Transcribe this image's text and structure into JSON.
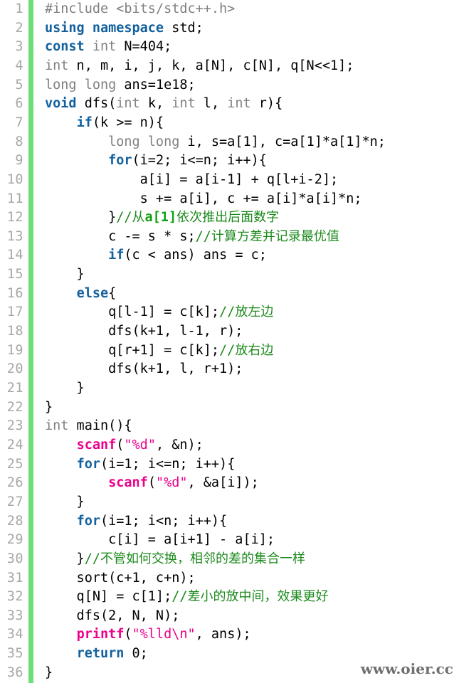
{
  "editor": {
    "language": "cpp",
    "background_color": "#ffffff",
    "gutter_bar_color": "#6fdd78",
    "line_number_color": "#a7a7a7",
    "total_lines": 36,
    "colors": {
      "keyword": "#12619e",
      "type": "#808080",
      "preprocessor": "#808080",
      "comment": "#1c8a1c",
      "comment_emphasis": "#13a013",
      "function": "#ec008c",
      "string": "#ec008c",
      "plain": "#000000"
    }
  },
  "watermark": {
    "text": "www.oier.cc"
  },
  "lines": [
    {
      "n": "1",
      "tokens": [
        {
          "t": "preproc",
          "s": "#include <bits/stdc++.h>"
        }
      ]
    },
    {
      "n": "2",
      "tokens": [
        {
          "t": "keyword",
          "s": "using namespace"
        },
        {
          "t": "plain",
          "s": " std;"
        }
      ]
    },
    {
      "n": "3",
      "tokens": [
        {
          "t": "keyword",
          "s": "const"
        },
        {
          "t": "plain",
          "s": " "
        },
        {
          "t": "type",
          "s": "int"
        },
        {
          "t": "plain",
          "s": " N=404;"
        }
      ]
    },
    {
      "n": "4",
      "tokens": [
        {
          "t": "type",
          "s": "int"
        },
        {
          "t": "plain",
          "s": " n, m, i, j, k, a[N], c[N], q[N<<1];"
        }
      ]
    },
    {
      "n": "5",
      "tokens": [
        {
          "t": "type",
          "s": "long long"
        },
        {
          "t": "plain",
          "s": " ans=1e18;"
        }
      ]
    },
    {
      "n": "6",
      "tokens": [
        {
          "t": "keyword",
          "s": "void"
        },
        {
          "t": "plain",
          "s": " dfs("
        },
        {
          "t": "type",
          "s": "int"
        },
        {
          "t": "plain",
          "s": " k, "
        },
        {
          "t": "type",
          "s": "int"
        },
        {
          "t": "plain",
          "s": " l, "
        },
        {
          "t": "type",
          "s": "int"
        },
        {
          "t": "plain",
          "s": " r){"
        }
      ]
    },
    {
      "n": "7",
      "tokens": [
        {
          "t": "plain",
          "s": "    "
        },
        {
          "t": "keyword",
          "s": "if"
        },
        {
          "t": "plain",
          "s": "(k >= n){"
        }
      ]
    },
    {
      "n": "8",
      "tokens": [
        {
          "t": "plain",
          "s": "        "
        },
        {
          "t": "type",
          "s": "long long"
        },
        {
          "t": "plain",
          "s": " i, s=a[1], c=a[1]*a[1]*n;"
        }
      ]
    },
    {
      "n": "9",
      "tokens": [
        {
          "t": "plain",
          "s": "        "
        },
        {
          "t": "keyword",
          "s": "for"
        },
        {
          "t": "plain",
          "s": "(i=2; i<=n; i++){"
        }
      ]
    },
    {
      "n": "10",
      "tokens": [
        {
          "t": "plain",
          "s": "            a[i] = a[i-1] + q[l+i-2];"
        }
      ]
    },
    {
      "n": "11",
      "tokens": [
        {
          "t": "plain",
          "s": "            s += a[i], c += a[i]*a[i]*n;"
        }
      ]
    },
    {
      "n": "12",
      "tokens": [
        {
          "t": "plain",
          "s": "        }"
        },
        {
          "t": "comment",
          "s": "//"
        },
        {
          "t": "comment-cjk",
          "s": "从"
        },
        {
          "t": "comment-em",
          "s": "a[1]"
        },
        {
          "t": "comment-cjk",
          "s": "依次推出后面数字"
        }
      ]
    },
    {
      "n": "13",
      "tokens": [
        {
          "t": "plain",
          "s": "        c -= s * s;"
        },
        {
          "t": "comment",
          "s": "//"
        },
        {
          "t": "comment-cjk",
          "s": "计算方差并记录最优值"
        }
      ]
    },
    {
      "n": "14",
      "tokens": [
        {
          "t": "plain",
          "s": "        "
        },
        {
          "t": "keyword",
          "s": "if"
        },
        {
          "t": "plain",
          "s": "(c < ans) ans = c;"
        }
      ]
    },
    {
      "n": "15",
      "tokens": [
        {
          "t": "plain",
          "s": "    }"
        }
      ]
    },
    {
      "n": "16",
      "tokens": [
        {
          "t": "plain",
          "s": "    "
        },
        {
          "t": "keyword",
          "s": "else"
        },
        {
          "t": "plain",
          "s": "{"
        }
      ]
    },
    {
      "n": "17",
      "tokens": [
        {
          "t": "plain",
          "s": "        q[l-1] = c[k];"
        },
        {
          "t": "comment",
          "s": "//"
        },
        {
          "t": "comment-cjk",
          "s": "放左边"
        }
      ]
    },
    {
      "n": "18",
      "tokens": [
        {
          "t": "plain",
          "s": "        dfs(k+1, l-1, r);"
        }
      ]
    },
    {
      "n": "19",
      "tokens": [
        {
          "t": "plain",
          "s": "        q[r+1] = c[k];"
        },
        {
          "t": "comment",
          "s": "//"
        },
        {
          "t": "comment-cjk",
          "s": "放右边"
        }
      ]
    },
    {
      "n": "20",
      "tokens": [
        {
          "t": "plain",
          "s": "        dfs(k+1, l, r+1);"
        }
      ]
    },
    {
      "n": "21",
      "tokens": [
        {
          "t": "plain",
          "s": "    }"
        }
      ]
    },
    {
      "n": "22",
      "tokens": [
        {
          "t": "plain",
          "s": "}"
        }
      ]
    },
    {
      "n": "23",
      "tokens": [
        {
          "t": "type",
          "s": "int"
        },
        {
          "t": "plain",
          "s": " main(){"
        }
      ]
    },
    {
      "n": "24",
      "tokens": [
        {
          "t": "plain",
          "s": "    "
        },
        {
          "t": "func",
          "s": "scanf"
        },
        {
          "t": "plain",
          "s": "("
        },
        {
          "t": "string",
          "s": "\"%d\""
        },
        {
          "t": "plain",
          "s": ", &n);"
        }
      ]
    },
    {
      "n": "25",
      "tokens": [
        {
          "t": "plain",
          "s": "    "
        },
        {
          "t": "keyword",
          "s": "for"
        },
        {
          "t": "plain",
          "s": "(i=1; i<=n; i++){"
        }
      ]
    },
    {
      "n": "26",
      "tokens": [
        {
          "t": "plain",
          "s": "        "
        },
        {
          "t": "func",
          "s": "scanf"
        },
        {
          "t": "plain",
          "s": "("
        },
        {
          "t": "string",
          "s": "\"%d\""
        },
        {
          "t": "plain",
          "s": ", &a[i]);"
        }
      ]
    },
    {
      "n": "27",
      "tokens": [
        {
          "t": "plain",
          "s": "    }"
        }
      ]
    },
    {
      "n": "28",
      "tokens": [
        {
          "t": "plain",
          "s": "    "
        },
        {
          "t": "keyword",
          "s": "for"
        },
        {
          "t": "plain",
          "s": "(i=1; i<n; i++){"
        }
      ]
    },
    {
      "n": "29",
      "tokens": [
        {
          "t": "plain",
          "s": "        c[i] = a[i+1] - a[i];"
        }
      ]
    },
    {
      "n": "30",
      "tokens": [
        {
          "t": "plain",
          "s": "    }"
        },
        {
          "t": "comment",
          "s": "//"
        },
        {
          "t": "comment-cjk",
          "s": "不管如何交换，相邻的差的集合一样"
        }
      ]
    },
    {
      "n": "31",
      "tokens": [
        {
          "t": "plain",
          "s": "    sort(c+1, c+n);"
        }
      ]
    },
    {
      "n": "32",
      "tokens": [
        {
          "t": "plain",
          "s": "    q[N] = c[1];"
        },
        {
          "t": "comment",
          "s": "//"
        },
        {
          "t": "comment-cjk",
          "s": "差小的放中间，效果更好"
        }
      ]
    },
    {
      "n": "33",
      "tokens": [
        {
          "t": "plain",
          "s": "    dfs(2, N, N);"
        }
      ]
    },
    {
      "n": "34",
      "tokens": [
        {
          "t": "plain",
          "s": "    "
        },
        {
          "t": "func",
          "s": "printf"
        },
        {
          "t": "plain",
          "s": "("
        },
        {
          "t": "string",
          "s": "\"%lld\\n\""
        },
        {
          "t": "plain",
          "s": ", ans);"
        }
      ]
    },
    {
      "n": "35",
      "tokens": [
        {
          "t": "plain",
          "s": "    "
        },
        {
          "t": "keyword",
          "s": "return"
        },
        {
          "t": "plain",
          "s": " 0;"
        }
      ]
    },
    {
      "n": "36",
      "tokens": [
        {
          "t": "plain",
          "s": "}"
        }
      ]
    }
  ]
}
